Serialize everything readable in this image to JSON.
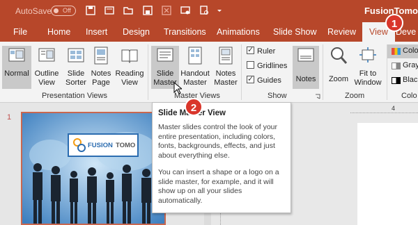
{
  "titlebar": {
    "autosave_label": "AutoSave",
    "autosave_state": "Off",
    "app_title": "FusionTomo"
  },
  "tabs": [
    "File",
    "Home",
    "Insert",
    "Design",
    "Transitions",
    "Animations",
    "Slide Show",
    "Review",
    "View",
    "Deve"
  ],
  "active_tab": "View",
  "ribbon": {
    "presentation_views": {
      "label": "Presentation Views",
      "buttons": [
        "Normal",
        "Outline View",
        "Slide Sorter",
        "Notes Page",
        "Reading View"
      ]
    },
    "master_views": {
      "label": "Master Views",
      "buttons": [
        "Slide Master",
        "Handout Master",
        "Notes Master"
      ]
    },
    "show": {
      "label": "Show",
      "items": [
        {
          "label": "Ruler",
          "checked": true
        },
        {
          "label": "Gridlines",
          "checked": false
        },
        {
          "label": "Guides",
          "checked": true
        }
      ],
      "notes_label": "Notes"
    },
    "zoom": {
      "label": "Zoom",
      "buttons": [
        "Zoom",
        "Fit to Window"
      ]
    },
    "color": {
      "label": "Colo",
      "items": [
        "Colo",
        "Gray",
        "Blac"
      ]
    }
  },
  "badges": {
    "one": "1",
    "two": "2"
  },
  "slide": {
    "number": "1",
    "logo_text_fusion": "FUSION",
    "logo_text_tomo": "TOMO"
  },
  "ruler": {
    "marker": "4"
  },
  "tooltip": {
    "title": "Slide Master View",
    "p1": "Master slides control the look of your entire presentation, including colors, fonts, backgrounds, effects, and just about everything else.",
    "p2": "You can insert a shape or a logo on a slide master, for example, and it will show up on all your slides automatically."
  },
  "colors": {
    "accent": "#b7472a",
    "badge": "#d9362b"
  }
}
